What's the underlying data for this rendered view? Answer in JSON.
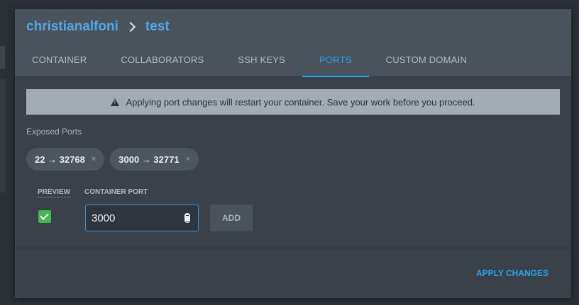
{
  "breadcrumb": {
    "owner": "christianalfoni",
    "project": "test"
  },
  "tabs": [
    {
      "label": "CONTAINER",
      "active": false
    },
    {
      "label": "COLLABORATORS",
      "active": false
    },
    {
      "label": "SSH KEYS",
      "active": false
    },
    {
      "label": "PORTS",
      "active": true
    },
    {
      "label": "CUSTOM DOMAIN",
      "active": false
    }
  ],
  "warning": {
    "icon": "warning-triangle-icon",
    "text": "Applying port changes will restart your container. Save your work before you proceed."
  },
  "exposed_ports": {
    "label": "Exposed Ports",
    "chips": [
      {
        "label": "22 → 32768",
        "remove_glyph": "×"
      },
      {
        "label": "3000 → 32771",
        "remove_glyph": "×"
      }
    ]
  },
  "form": {
    "preview_label": "PREVIEW",
    "preview_checked": true,
    "container_port_label": "CONTAINER PORT",
    "container_port_value": "3000",
    "add_label": "ADD"
  },
  "footer": {
    "apply_label": "APPLY CHANGES"
  },
  "colors": {
    "accent": "#2aa4f0",
    "link": "#4fa9e6",
    "check": "#3fb84e",
    "warning_bg": "#a3abb3"
  }
}
